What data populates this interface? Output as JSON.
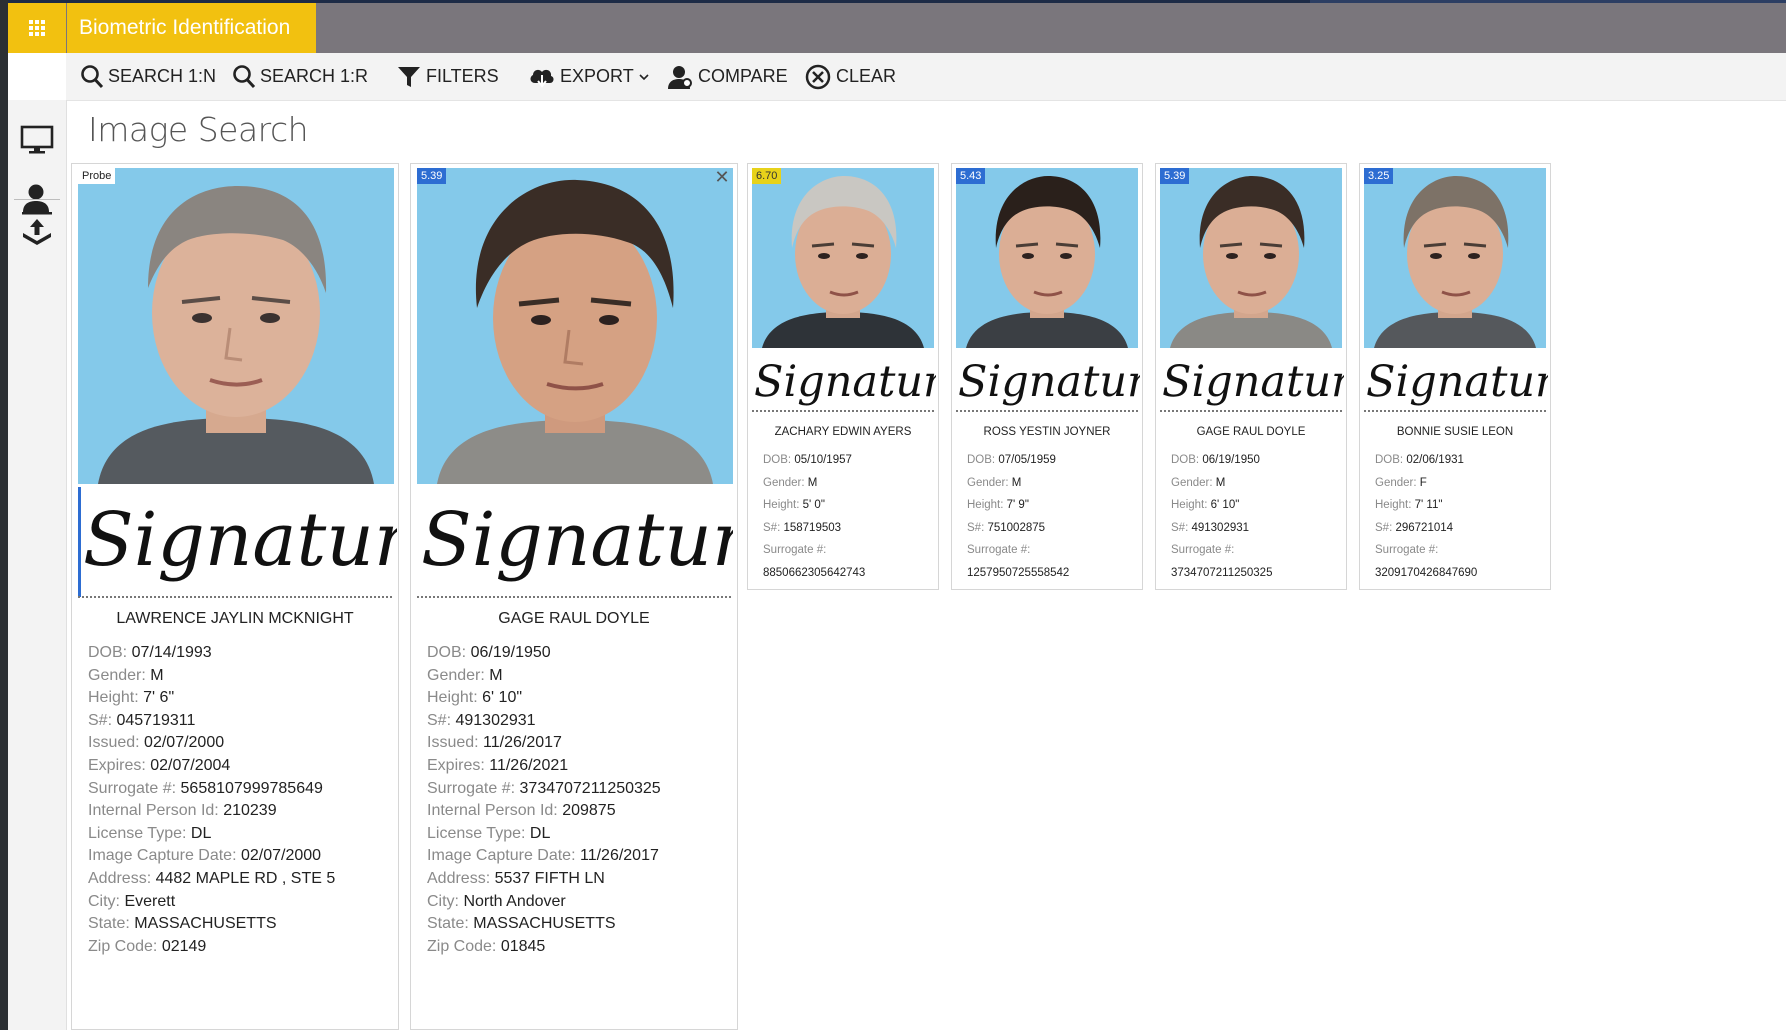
{
  "app": {
    "title": "Biometric Identification"
  },
  "toolbar": {
    "search_1n": "SEARCH 1:N",
    "search_1r": "SEARCH 1:R",
    "filters": "FILTERS",
    "export": "EXPORT",
    "compare": "COMPARE",
    "clear": "CLEAR"
  },
  "sidenav": {
    "items": [
      {
        "icon": "monitor-icon"
      },
      {
        "icon": "person-search-icon"
      },
      {
        "icon": "upload-tray-icon"
      }
    ]
  },
  "page": {
    "title": "Image Search"
  },
  "labels": {
    "dob": "DOB:",
    "gender": "Gender:",
    "height": "Height:",
    "snum": "S#:",
    "issued": "Issued:",
    "expires": "Expires:",
    "surrogate": "Surrogate #:",
    "internal_id": "Internal Person Id:",
    "license_type": "License Type:",
    "capture_date": "Image Capture Date:",
    "address": "Address:",
    "city": "City:",
    "state": "State:",
    "zip": "Zip Code:"
  },
  "signature_text": "Signature",
  "probe": {
    "badge": "Probe",
    "name": "LAWRENCE JAYLIN MCKNIGHT",
    "dob": "07/14/1993",
    "gender": "M",
    "height": "7' 6\"",
    "snum": "045719311",
    "issued": "02/07/2000",
    "expires": "02/07/2004",
    "surrogate": "5658107999785649",
    "internal_id": "210239",
    "license_type": "DL",
    "capture_date": "02/07/2000",
    "address": "4482 MAPLE RD , STE 5",
    "city": "Everett",
    "state": "MASSACHUSETTS",
    "zip": "02149"
  },
  "selected": {
    "score": "5.39",
    "close_icon": "close-icon",
    "name": "GAGE RAUL DOYLE",
    "dob": "06/19/1950",
    "gender": "M",
    "height": "6' 10\"",
    "snum": "491302931",
    "issued": "11/26/2017",
    "expires": "11/26/2021",
    "surrogate": "3734707211250325",
    "internal_id": "209875",
    "license_type": "DL",
    "capture_date": "11/26/2017",
    "address": "5537 FIFTH LN",
    "city": "North Andover",
    "state": "MASSACHUSETTS",
    "zip": "01845"
  },
  "candidates": [
    {
      "score": "6.70",
      "name": "ZACHARY EDWIN AYERS",
      "dob": "05/10/1957",
      "gender": "M",
      "height": "5' 0\"",
      "snum": "158719503",
      "surrogate": "8850662305642743",
      "color": "#e7d21a"
    },
    {
      "score": "5.43",
      "name": "ROSS YESTIN JOYNER",
      "dob": "07/05/1959",
      "gender": "M",
      "height": "7' 9\"",
      "snum": "751002875",
      "surrogate": "1257950725558542",
      "color": "#2d6dd2"
    },
    {
      "score": "5.39",
      "name": "GAGE RAUL DOYLE",
      "dob": "06/19/1950",
      "gender": "M",
      "height": "6' 10\"",
      "snum": "491302931",
      "surrogate": "3734707211250325",
      "color": "#2d6dd2"
    },
    {
      "score": "3.25",
      "name": "BONNIE SUSIE LEON",
      "dob": "02/06/1931",
      "gender": "F",
      "height": "7' 11\"",
      "snum": "296721014",
      "surrogate": "3209170426847690",
      "color": "#2d6dd2"
    }
  ]
}
